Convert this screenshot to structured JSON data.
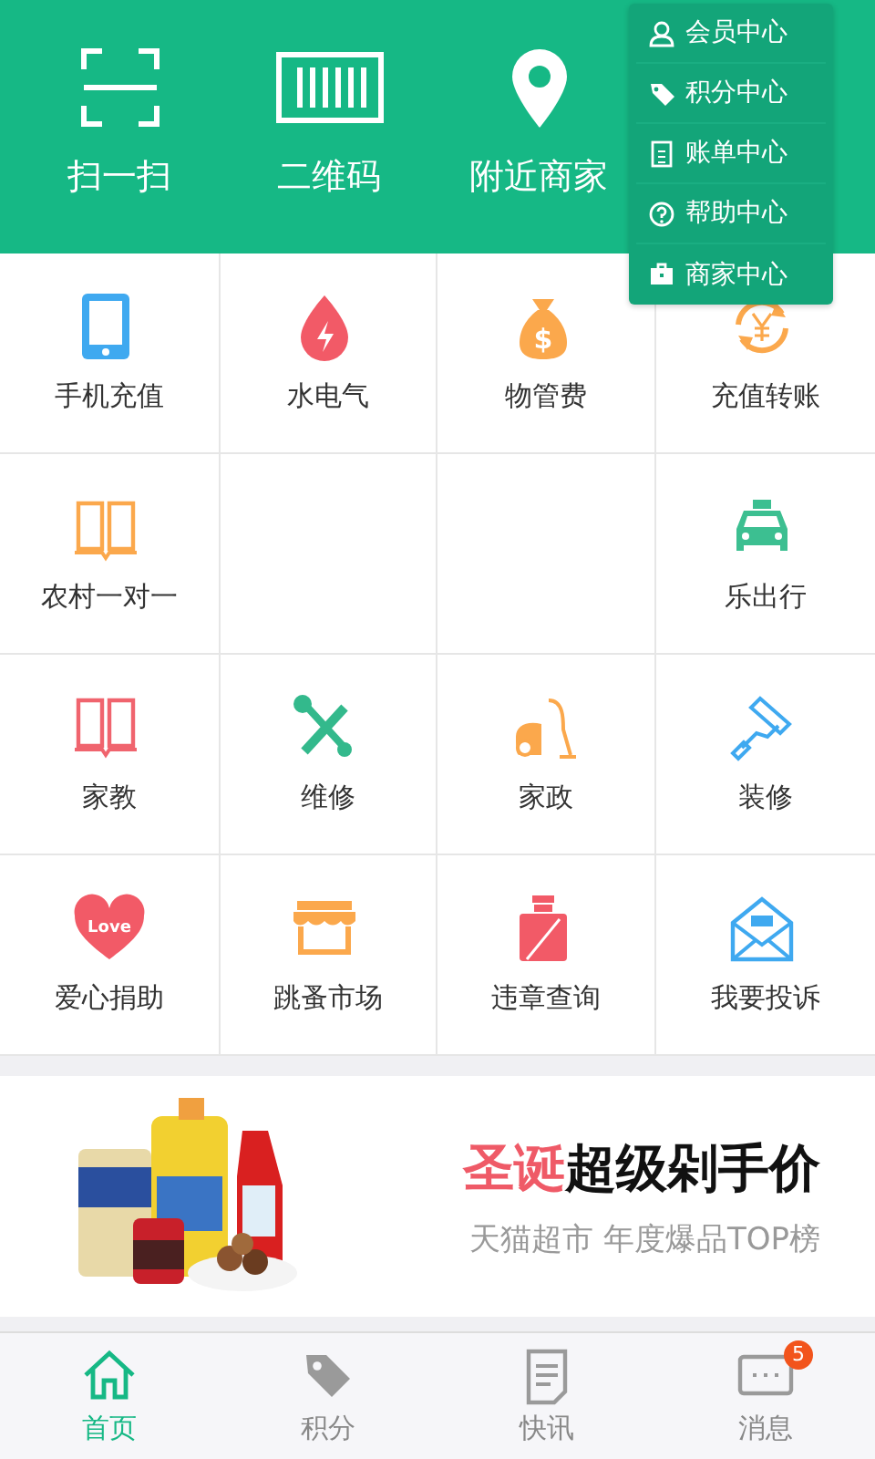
{
  "header": {
    "actions": [
      {
        "label": "扫一扫"
      },
      {
        "label": "二维码"
      },
      {
        "label": "附近商家"
      }
    ]
  },
  "menu": {
    "items": [
      {
        "label": "会员中心"
      },
      {
        "label": "积分中心"
      },
      {
        "label": "账单中心"
      },
      {
        "label": "帮助中心"
      },
      {
        "label": "商家中心"
      }
    ]
  },
  "services": [
    {
      "kind": "service",
      "label": "手机充值"
    },
    {
      "kind": "service",
      "label": "水电气"
    },
    {
      "kind": "service",
      "label": "物管费",
      "icon_text": "$"
    },
    {
      "kind": "service",
      "label": "充值转账"
    },
    {
      "kind": "service",
      "label": "农村一对一"
    },
    {
      "kind": "blank"
    },
    {
      "kind": "blank"
    },
    {
      "kind": "service",
      "label": "乐出行"
    },
    {
      "kind": "service",
      "label": "家教"
    },
    {
      "kind": "service",
      "label": "维修"
    },
    {
      "kind": "service",
      "label": "家政"
    },
    {
      "kind": "service",
      "label": "装修"
    },
    {
      "kind": "service",
      "label": "爱心捐助",
      "icon_text": "Love"
    },
    {
      "kind": "service",
      "label": "跳蚤市场"
    },
    {
      "kind": "service",
      "label": "违章查询"
    },
    {
      "kind": "service",
      "label": "我要投诉"
    }
  ],
  "banner": {
    "kind": "picture",
    "title": {
      "highlight": "圣诞",
      "rest": "超级剁手价"
    },
    "subtitle": "天猫超市 年度爆品TOP榜"
  },
  "nav": [
    {
      "label": "首页",
      "selected": true
    },
    {
      "label": "积分",
      "selected": false
    },
    {
      "label": "快讯",
      "selected": false
    },
    {
      "label": "消息",
      "selected": false,
      "badge": "5"
    }
  ]
}
